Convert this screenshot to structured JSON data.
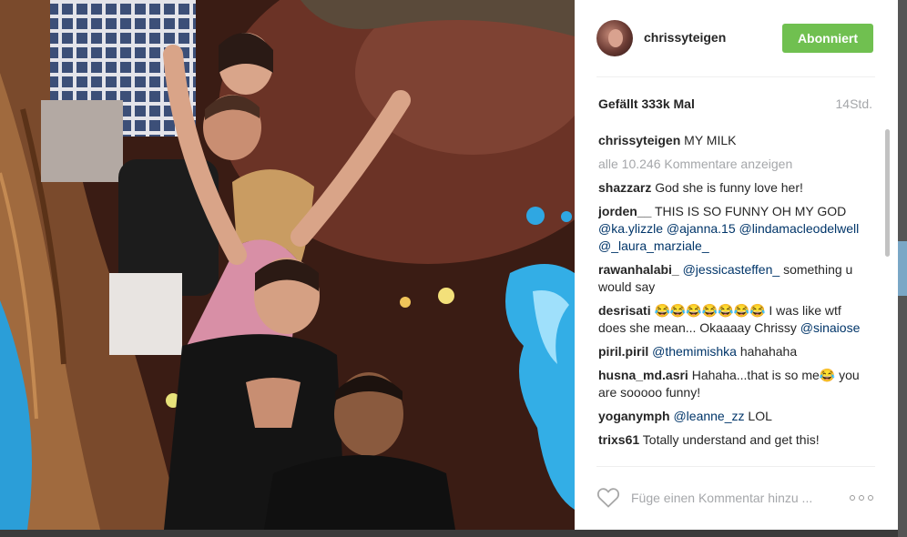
{
  "post": {
    "username": "chrissyteigen",
    "follow_label": "Abonniert",
    "likes_text": "Gefällt 333k Mal",
    "time_text": "14Std."
  },
  "comments": {
    "caption": {
      "user": "chrissyteigen",
      "text": "MY MILK"
    },
    "load_more": "alle 10.246 Kommentare anzeigen",
    "items": [
      {
        "user": "shazzarz",
        "text": "God she is funny love her!"
      },
      {
        "user": "jorden__",
        "text": "THIS IS SO FUNNY OH MY GOD",
        "mentions": [
          "@ka.ylizzle",
          "@ajanna.15",
          "@lindamacleodelwell",
          "@_laura_marziale_"
        ]
      },
      {
        "user": "rawanhalabi_",
        "mention": "@jessicasteffen_",
        "text": "something u would say"
      },
      {
        "user": "desrisati",
        "emoji": "😂😂😂😂😂😂😂",
        "text": "I was like wtf does she mean... Okaaaay Chrissy",
        "mention": "@sinaiose"
      },
      {
        "user": "piril.piril",
        "mention": "@themimishka",
        "text": "hahahaha"
      },
      {
        "user": "husna_md.asri",
        "text": "Hahaha...that is so me",
        "emoji": "😂",
        "text2": "you are sooooo funny!"
      },
      {
        "user": "yoganymph",
        "mention": "@leanne_zz",
        "text": "LOL"
      },
      {
        "user": "trixs61",
        "text": "Totally understand and get this!"
      }
    ]
  },
  "composer": {
    "placeholder": "Füge einen Kommentar hinzu ..."
  },
  "icons": {
    "like": "heart-icon",
    "more": "more-options-icon"
  },
  "colors": {
    "follow_button": "#70c050",
    "mention": "#003569",
    "muted": "#a5a7aa"
  }
}
